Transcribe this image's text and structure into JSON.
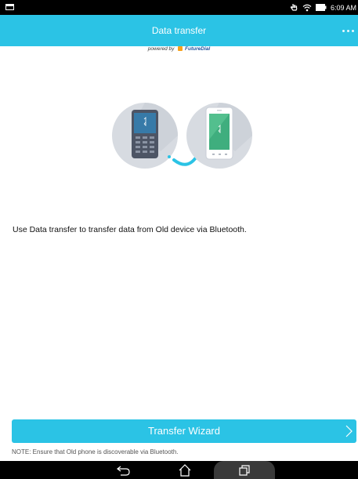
{
  "status_bar": {
    "time": "6:09 AM"
  },
  "app_bar": {
    "title": "Data transfer"
  },
  "powered_by": {
    "prefix": "powered by",
    "brand": "FutureDial"
  },
  "main": {
    "description": "Use Data transfer to transfer data from Old device via Bluetooth."
  },
  "wizard_button": {
    "label": "Transfer Wizard"
  },
  "note": "NOTE: Ensure that Old phone is discoverable via Bluetooth.",
  "colors": {
    "accent": "#2bc3e5",
    "status_bar": "#000000",
    "nav_bar": "#000000"
  },
  "icons": [
    "notification-icon",
    "touch-icon",
    "wifi-icon",
    "battery-icon",
    "overflow-menu-icon",
    "old-phone-icon",
    "transfer-arrow-icon",
    "new-phone-icon",
    "chevron-right-icon",
    "back-icon",
    "home-icon",
    "recents-icon"
  ]
}
